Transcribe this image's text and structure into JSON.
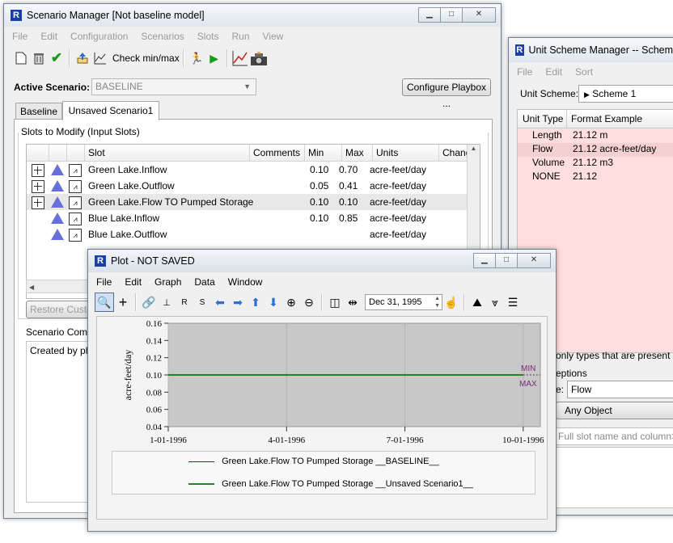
{
  "scenario_manager": {
    "title": "Scenario Manager [Not baseline model]",
    "menu": [
      "File",
      "Edit",
      "Configuration",
      "Scenarios",
      "Slots",
      "Run",
      "View"
    ],
    "check_label": "Check min/max",
    "active_label": "Active Scenario:",
    "active_value": "BASELINE",
    "config_playbox": "Configure Playbox ...",
    "tabs": [
      "Baseline",
      "Unsaved Scenario1"
    ],
    "slots_group": "Slots to Modify (Input Slots)",
    "columns": [
      "Slot",
      "Comments",
      "Min",
      "Max",
      "Units",
      "Change"
    ],
    "rows": [
      {
        "slot": "Green Lake.Inflow",
        "comments": "",
        "min": "0.10",
        "max": "0.70",
        "units": "acre-feet/day",
        "expand": true
      },
      {
        "slot": "Green Lake.Outflow",
        "comments": "",
        "min": "0.05",
        "max": "0.41",
        "units": "acre-feet/day",
        "expand": true
      },
      {
        "slot": "Green Lake.Flow TO Pumped Storage",
        "comments": "",
        "min": "0.10",
        "max": "0.10",
        "units": "acre-feet/day",
        "expand": true
      },
      {
        "slot": "Blue Lake.Inflow",
        "comments": "",
        "min": "0.10",
        "max": "0.85",
        "units": "acre-feet/day",
        "expand": false
      },
      {
        "slot": "Blue Lake.Outflow",
        "comments": "",
        "min": "",
        "max": "",
        "units": "acre-feet/day",
        "expand": false
      }
    ],
    "restore_label": "Restore Custo",
    "comments_group": "Scenario Comme",
    "created_by": "Created by phil"
  },
  "unit_scheme": {
    "title": "Unit Scheme Manager -- Scheme",
    "menu": [
      "File",
      "Edit",
      "Sort"
    ],
    "scheme_label": "Unit Scheme:",
    "scheme_value": "Scheme 1",
    "columns": [
      "Unit Type",
      "Format Example"
    ],
    "rows": [
      {
        "type": "Length",
        "example": "21.12 m"
      },
      {
        "type": "Flow",
        "example": "21.12 acre-feet/day"
      },
      {
        "type": "Volume",
        "example": "21.12 m3"
      },
      {
        "type": "NONE",
        "example": "21.12"
      }
    ],
    "note": "only types that are present on",
    "exceptions": "eptions",
    "e_label": "e:",
    "flow_value": "Flow",
    "any_object": "Any Object",
    "placeholder": "Full slot name and column>"
  },
  "plot": {
    "title": "Plot - NOT SAVED",
    "menu": [
      "File",
      "Edit",
      "Graph",
      "Data",
      "Window"
    ],
    "date_value": "Dec 31, 1995",
    "legend": [
      {
        "label": "Green Lake.Flow TO Pumped Storage __BASELINE__",
        "color": "#7a1020"
      },
      {
        "label": "Green Lake.Flow TO Pumped Storage __Unsaved Scenario1__",
        "color": "#1a8a1a"
      }
    ],
    "min_label": "MIN",
    "max_label": "MAX"
  },
  "chart_data": {
    "type": "line",
    "ylabel": "acre-feet/day",
    "xlabel": "",
    "title": "",
    "yticks": [
      "0.16",
      "0.14",
      "0.12",
      "0.10",
      "0.08",
      "0.06",
      "0.04"
    ],
    "ylim": [
      0.04,
      0.16
    ],
    "xticks": [
      "1-01-1996",
      "4-01-1996",
      "7-01-1996",
      "10-01-1996"
    ],
    "series": [
      {
        "name": "Green Lake.Flow TO Pumped Storage __BASELINE__",
        "values": [
          0.1,
          0.1,
          0.1,
          0.1
        ]
      },
      {
        "name": "Green Lake.Flow TO Pumped Storage __Unsaved Scenario1__",
        "values": [
          0.1,
          0.1,
          0.1,
          0.1
        ]
      }
    ],
    "min_line": 0.1,
    "max_line": 0.1,
    "grid": true
  }
}
